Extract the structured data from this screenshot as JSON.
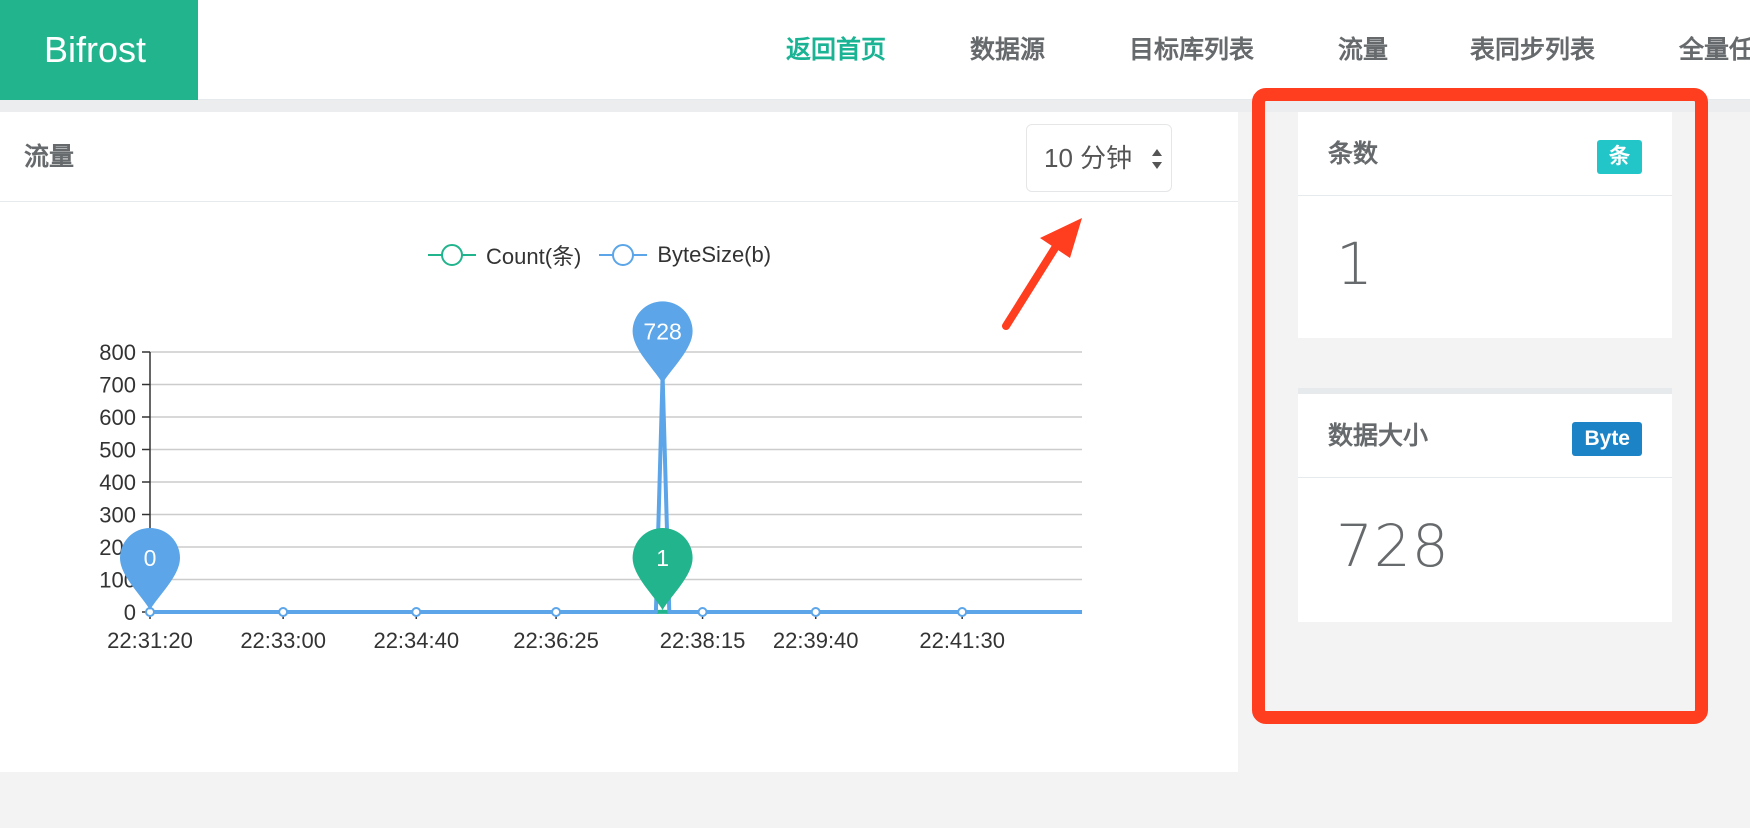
{
  "app": {
    "brand": "Bifrost"
  },
  "nav": {
    "items": [
      {
        "label": "返回首页",
        "active": true
      },
      {
        "label": "数据源",
        "active": false
      },
      {
        "label": "目标库列表",
        "active": false
      },
      {
        "label": "流量",
        "active": false
      },
      {
        "label": "表同步列表",
        "active": false
      },
      {
        "label": "全量任",
        "active": false
      }
    ]
  },
  "panel": {
    "title": "流量",
    "range_select": {
      "selected": "10 分钟"
    }
  },
  "cards": [
    {
      "title": "条数",
      "badge": "条",
      "badge_color": "#23c6c8",
      "value": "1"
    },
    {
      "title": "数据大小",
      "badge": "Byte",
      "badge_color": "#1c84c6",
      "value": "728"
    }
  ],
  "colors": {
    "brand": "#22b48d",
    "count_series": "#22b48d",
    "bytesize_series": "#5ba5e8",
    "highlight": "#ff3d1f"
  },
  "chart_data": {
    "type": "line",
    "title": "",
    "xlabel": "",
    "ylabel": "",
    "ylim": [
      0,
      800
    ],
    "yticks": [
      0,
      100,
      200,
      300,
      400,
      500,
      600,
      700,
      800
    ],
    "x_ticks": [
      "22:31:20",
      "22:33:00",
      "22:34:40",
      "22:36:25",
      "22:38:15",
      "22:39:40",
      "22:41:30"
    ],
    "legend": {
      "placement": "top-center",
      "entries": [
        "Count(条)",
        "ByteSize(b)"
      ]
    },
    "grid": true,
    "series": [
      {
        "name": "Count(条)",
        "color": "#22b48d",
        "points": [
          {
            "x": "22:31:20",
            "y": 0
          },
          {
            "x": "22:33:00",
            "y": 0
          },
          {
            "x": "22:34:40",
            "y": 0
          },
          {
            "x": "22:36:25",
            "y": 0
          },
          {
            "x": "22:37:40",
            "y": 0
          },
          {
            "x": "22:37:45",
            "y": 1
          },
          {
            "x": "22:37:50",
            "y": 0
          },
          {
            "x": "22:38:15",
            "y": 0
          },
          {
            "x": "22:39:40",
            "y": 0
          },
          {
            "x": "22:41:30",
            "y": 0
          },
          {
            "x": "22:43:00",
            "y": 0
          }
        ],
        "markers": [
          {
            "label": "1",
            "x": "22:37:45",
            "y": 1
          }
        ]
      },
      {
        "name": "ByteSize(b)",
        "color": "#5ba5e8",
        "points": [
          {
            "x": "22:31:20",
            "y": 0
          },
          {
            "x": "22:33:00",
            "y": 0
          },
          {
            "x": "22:34:40",
            "y": 0
          },
          {
            "x": "22:36:25",
            "y": 0
          },
          {
            "x": "22:37:40",
            "y": 0
          },
          {
            "x": "22:37:45",
            "y": 728
          },
          {
            "x": "22:37:50",
            "y": 0
          },
          {
            "x": "22:38:15",
            "y": 0
          },
          {
            "x": "22:39:40",
            "y": 0
          },
          {
            "x": "22:41:30",
            "y": 0
          },
          {
            "x": "22:43:00",
            "y": 0
          }
        ],
        "markers": [
          {
            "label": "728",
            "x": "22:37:45",
            "y": 728
          },
          {
            "label": "0",
            "x": "22:31:20",
            "y": 0
          }
        ]
      }
    ]
  }
}
